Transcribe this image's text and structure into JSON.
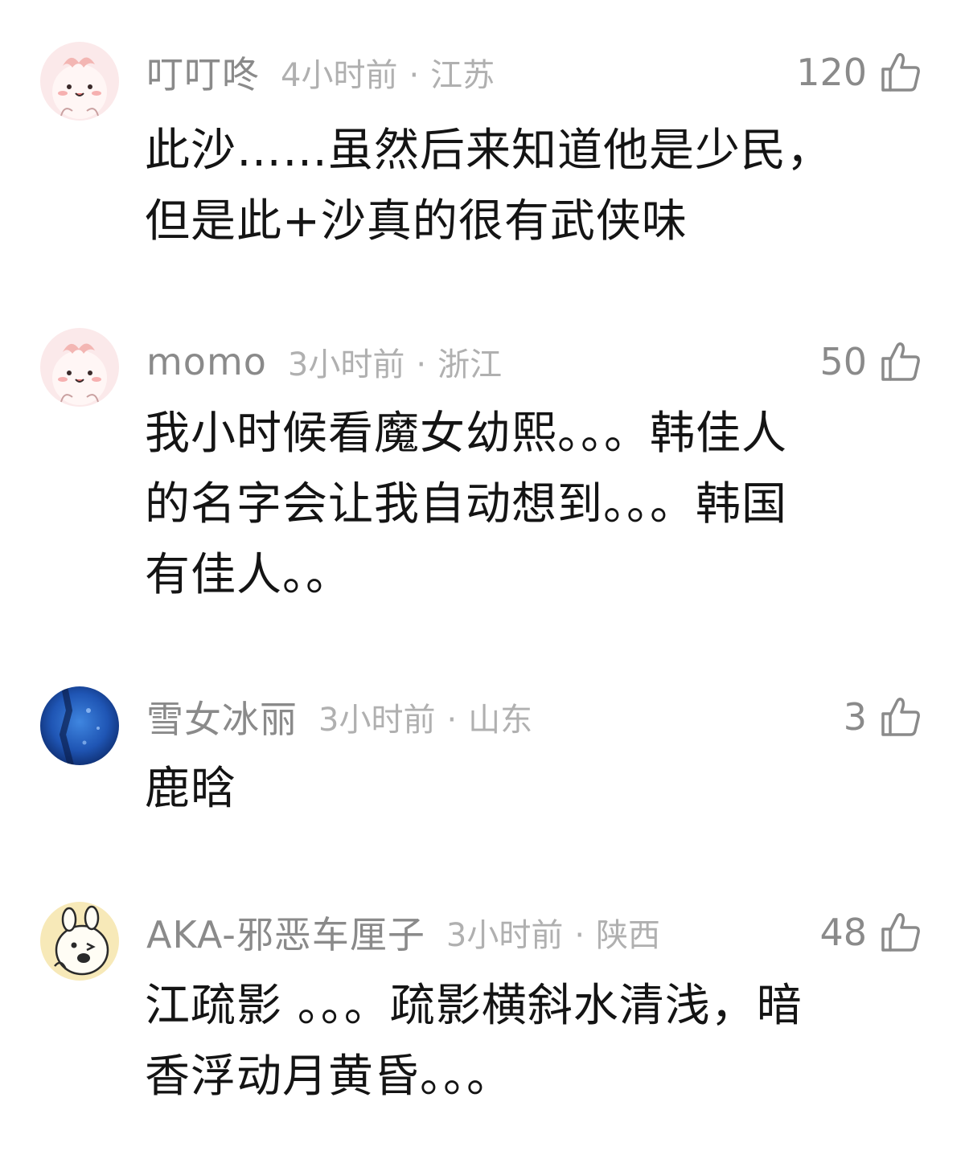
{
  "comments": [
    {
      "username": "叮叮咚",
      "time": "4小时前",
      "separator": "·",
      "location": "江苏",
      "likes": "120",
      "text_lines": [
        "此沙……虽然后来知道他是少民，",
        "但是此+沙真的很有武侠味"
      ],
      "avatar": "pink-cartoon-avatar"
    },
    {
      "username": "momo",
      "time": "3小时前",
      "separator": "·",
      "location": "浙江",
      "likes": "50",
      "text_lines": [
        "我小时候看魔女幼熙。。。韩佳人",
        "的名字会让我自动想到。。。韩国",
        "有佳人。。"
      ],
      "avatar": "pink-cartoon-avatar"
    },
    {
      "username": "雪女冰丽",
      "time": "3小时前",
      "separator": "·",
      "location": "山东",
      "likes": "3",
      "text_lines": [
        "鹿晗"
      ],
      "avatar": "blue-photo-avatar"
    },
    {
      "username": "AKA-邪恶车厘子",
      "time": "3小时前",
      "separator": "·",
      "location": "陕西",
      "likes": "48",
      "text_lines": [
        "江疏影 。。。疏影横斜水清浅，暗",
        "香浮动月黄昏。。。"
      ],
      "avatar": "bear-cartoon-avatar"
    }
  ],
  "colors": {
    "username": "#8a8a8a",
    "meta": "#b0b0b0",
    "text": "#141414",
    "icon": "#8a8a8a"
  },
  "icons": {
    "like": "thumbs-up-icon"
  }
}
